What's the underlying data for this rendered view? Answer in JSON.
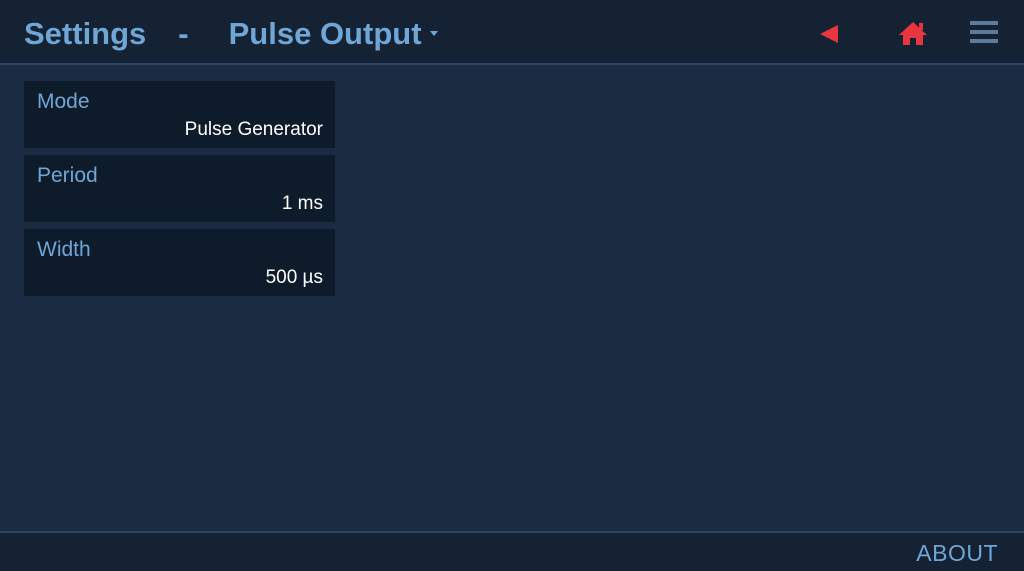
{
  "header": {
    "title": "Settings",
    "separator": "-",
    "section": "Pulse Output"
  },
  "toolbar": {
    "back_icon": "back-arrow-icon",
    "home_icon": "home-icon",
    "menu_icon": "hamburger-menu-icon"
  },
  "colors": {
    "accent": "#6fa6d6",
    "icon_active": "#e8363e",
    "icon_inactive": "#5c7a99",
    "background": "#1a2b42",
    "panel": "#0e1b2b"
  },
  "settings": [
    {
      "label": "Mode",
      "value": "Pulse Generator"
    },
    {
      "label": "Period",
      "value": "1 ms"
    },
    {
      "label": "Width",
      "value": "500 µs"
    }
  ],
  "footer": {
    "about_label": "ABOUT"
  }
}
